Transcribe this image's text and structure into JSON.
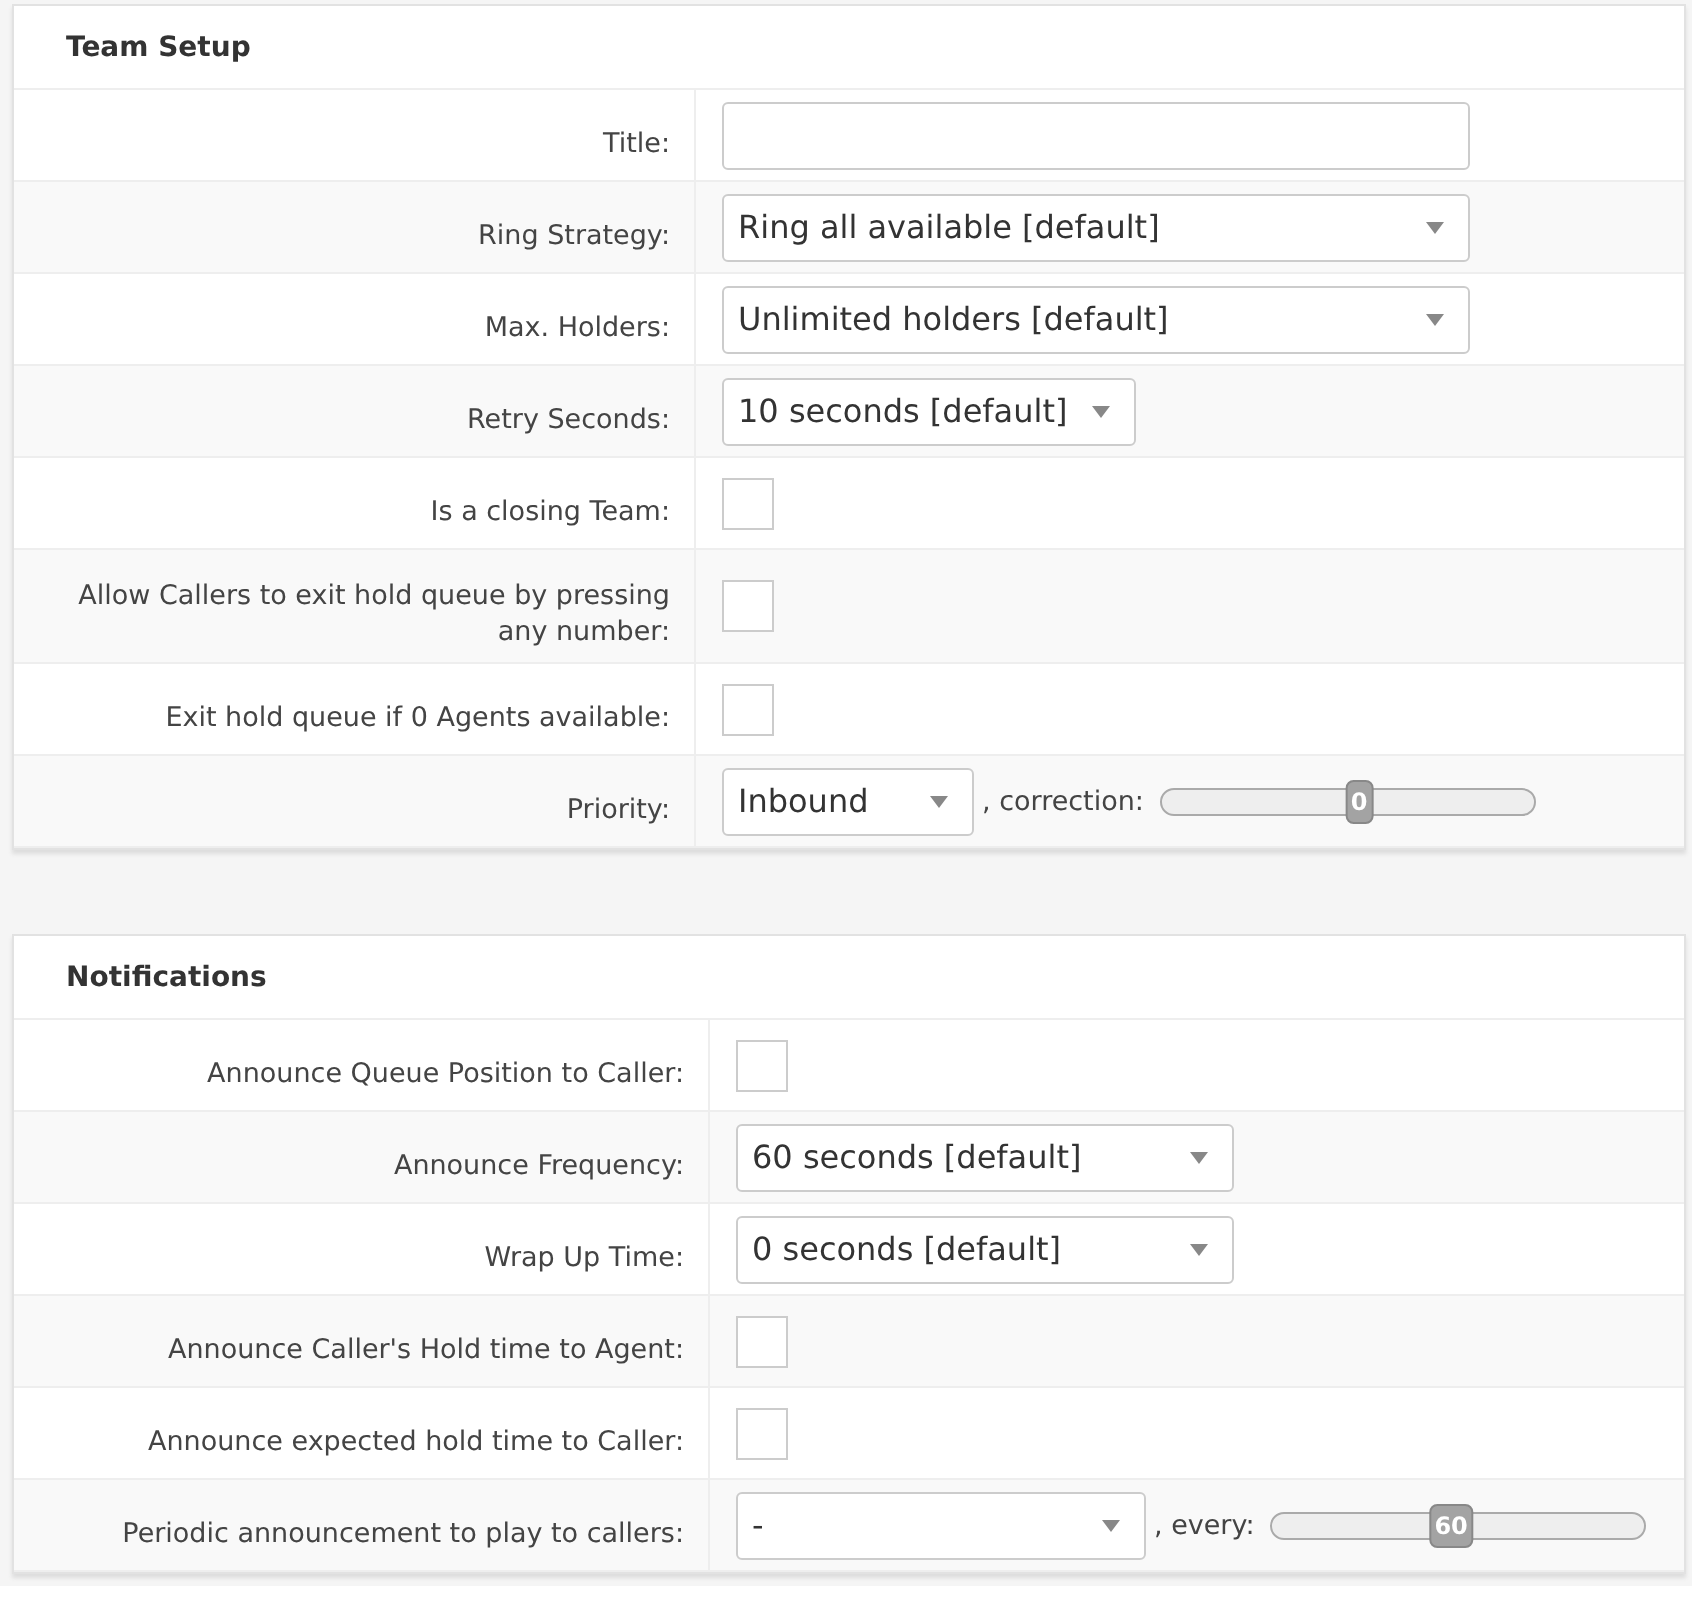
{
  "sections": [
    {
      "title": "Team Setup",
      "rows": [
        {
          "label": "Title:",
          "kind": "text"
        },
        {
          "label": "Ring Strategy:",
          "kind": "select",
          "value": "Ring all available [default]"
        },
        {
          "label": "Max. Holders:",
          "kind": "select",
          "value": "Unlimited holders [default]"
        },
        {
          "label": "Retry Seconds:",
          "kind": "select",
          "value": "10 seconds [default]"
        },
        {
          "label": "Is a closing Team:",
          "kind": "checkbox",
          "checked": false
        },
        {
          "label": "Allow Callers to exit hold queue by pressing any number:",
          "kind": "checkbox",
          "checked": false
        },
        {
          "label": "Exit hold queue if 0 Agents available:",
          "kind": "checkbox",
          "checked": false
        },
        {
          "label": "Priority:",
          "kind": "select_slider",
          "value": "Inbound",
          "suffix": ", correction:",
          "slider": {
            "level": 0.53,
            "reading": "0"
          }
        }
      ]
    },
    {
      "title": "Notifications",
      "rows": [
        {
          "label": "Announce Queue Position to Caller:",
          "kind": "checkbox",
          "checked": false
        },
        {
          "label": "Announce Frequency:",
          "kind": "select",
          "value": "60 seconds [default]"
        },
        {
          "label": "Wrap Up Time:",
          "kind": "select",
          "value": "0 seconds [default]"
        },
        {
          "label": "Announce Caller's Hold time to Agent:",
          "kind": "checkbox",
          "checked": false
        },
        {
          "label": "Announce expected hold time to Caller:",
          "kind": "checkbox",
          "checked": false
        },
        {
          "label": "Periodic announcement to play to callers:",
          "kind": "select_slider",
          "value": "-",
          "suffix": ", every:",
          "slider": {
            "level": 0.48,
            "reading": "60"
          }
        }
      ]
    }
  ]
}
